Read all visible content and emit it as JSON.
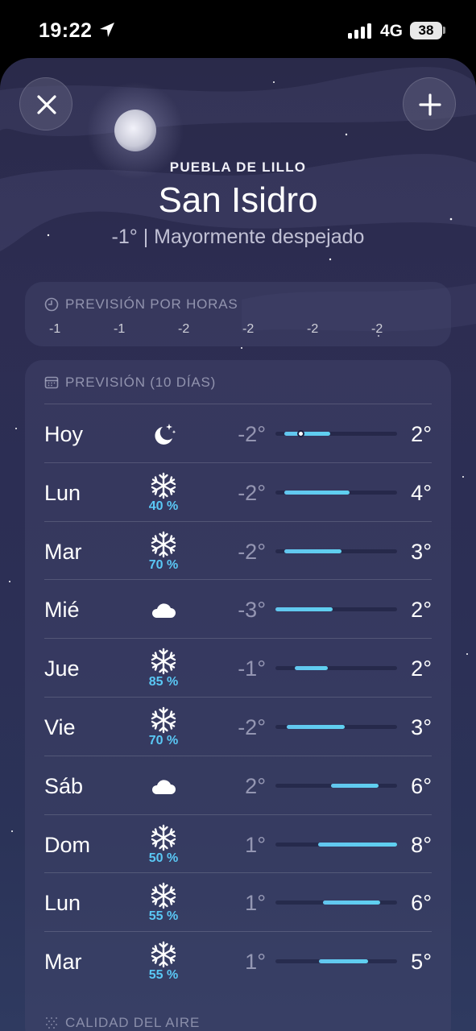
{
  "status_bar": {
    "time": "19:22",
    "network": "4G",
    "battery": "38"
  },
  "header": {
    "region": "PUEBLA DE LILLO",
    "city": "San Isidro",
    "summary": "-1°  |  Mayormente despejado"
  },
  "hourly": {
    "title": "PREVISIÓN POR HORAS",
    "ticks": [
      "-1",
      "-1",
      "-2",
      "-2",
      "-2",
      "-2"
    ]
  },
  "daily": {
    "title": "PREVISIÓN (10 DÍAS)",
    "rows": [
      {
        "day": "Hoy",
        "icon": "moon-stars-icon",
        "precip": "",
        "low": "-2°",
        "high": "2°",
        "bar_start": 0.07,
        "bar_end": 0.45,
        "current": 0.21
      },
      {
        "day": "Lun",
        "icon": "snowflake-icon",
        "precip": "40 %",
        "low": "-2°",
        "high": "4°",
        "bar_start": 0.07,
        "bar_end": 0.61
      },
      {
        "day": "Mar",
        "icon": "snowflake-icon",
        "precip": "70 %",
        "low": "-2°",
        "high": "3°",
        "bar_start": 0.07,
        "bar_end": 0.54
      },
      {
        "day": "Mié",
        "icon": "cloud-icon",
        "precip": "",
        "low": "-3°",
        "high": "2°",
        "bar_start": 0.0,
        "bar_end": 0.47
      },
      {
        "day": "Jue",
        "icon": "snowflake-icon",
        "precip": "85 %",
        "low": "-1°",
        "high": "2°",
        "bar_start": 0.16,
        "bar_end": 0.43
      },
      {
        "day": "Vie",
        "icon": "snowflake-icon",
        "precip": "70 %",
        "low": "-2°",
        "high": "3°",
        "bar_start": 0.09,
        "bar_end": 0.57
      },
      {
        "day": "Sáb",
        "icon": "cloud-icon",
        "precip": "",
        "low": "2°",
        "high": "6°",
        "bar_start": 0.46,
        "bar_end": 0.85
      },
      {
        "day": "Dom",
        "icon": "snowflake-icon",
        "precip": "50 %",
        "low": "1°",
        "high": "8°",
        "bar_start": 0.35,
        "bar_end": 1.0
      },
      {
        "day": "Lun",
        "icon": "snowflake-icon",
        "precip": "55 %",
        "low": "1°",
        "high": "6°",
        "bar_start": 0.39,
        "bar_end": 0.86
      },
      {
        "day": "Mar",
        "icon": "snowflake-icon",
        "precip": "55 %",
        "low": "1°",
        "high": "5°",
        "bar_start": 0.36,
        "bar_end": 0.76
      }
    ]
  },
  "air_quality": {
    "title": "CALIDAD DEL AIRE"
  },
  "colors": {
    "bar": "#5fc9f1",
    "precip": "#5ac8f5"
  }
}
